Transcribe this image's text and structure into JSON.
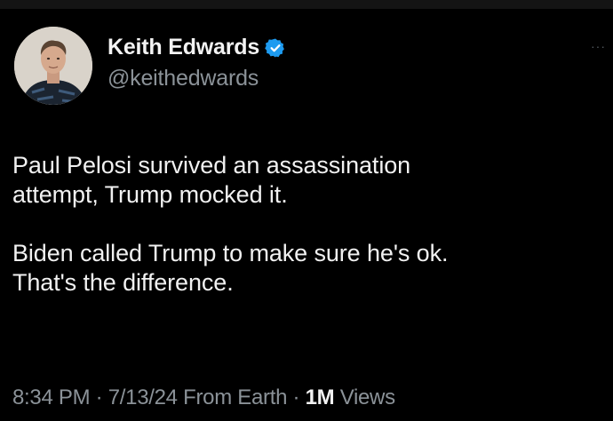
{
  "author": {
    "display_name": "Keith Edwards",
    "handle": "@keithedwards",
    "verified": true,
    "verified_color": "#1d9bf0"
  },
  "menu": {
    "icon": "more-dots-icon"
  },
  "tweet": {
    "paragraph_1_line_1": "Paul Pelosi survived an assassination",
    "paragraph_1_line_2": "attempt, Trump mocked it.",
    "paragraph_2_line_1": "Biden called Trump to make sure he's ok.",
    "paragraph_2_line_2": "That's the difference."
  },
  "meta": {
    "time": "8:34 PM",
    "separator": "·",
    "date": "7/13/24",
    "source": "From Earth",
    "views_count": "1M",
    "views_label": "Views"
  },
  "colors": {
    "background": "#000000",
    "text": "#e7e9ea",
    "secondary": "#8b9298",
    "accent": "#1d9bf0"
  }
}
